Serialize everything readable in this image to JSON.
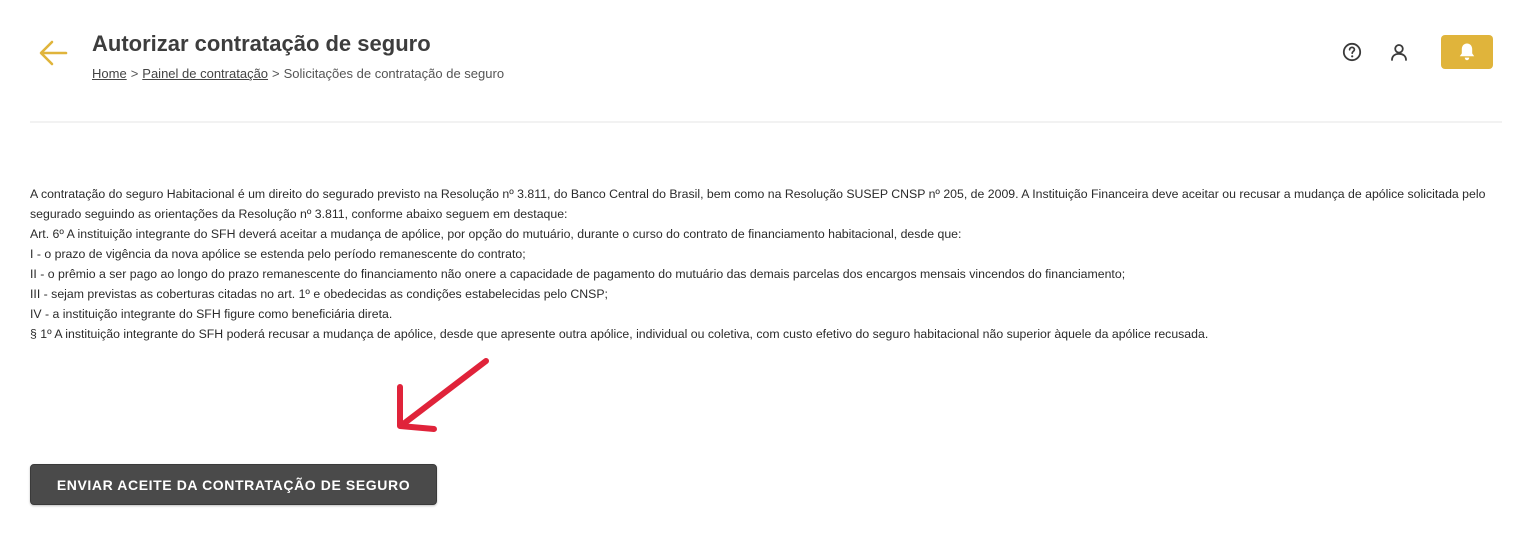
{
  "header": {
    "title": "Autorizar contratação de seguro",
    "breadcrumb": {
      "items": [
        "Home",
        "Painel de contratação"
      ],
      "separator": ">",
      "current": "Solicitações de contratação de seguro"
    },
    "icons": {
      "back": "arrow-left-icon",
      "help": "help-circle-icon",
      "user": "user-icon",
      "notifications": "bell-icon"
    }
  },
  "colors": {
    "accent": "#e0b43b",
    "button_bg": "#4a4a4a",
    "annotation_arrow": "#e0233a"
  },
  "content": {
    "paragraphs": [
      "A contratação do seguro Habitacional é um direito do segurado previsto na Resolução nº 3.811, do Banco Central do Brasil, bem como na Resolução SUSEP CNSP nº 205, de 2009. A Instituição Financeira deve aceitar ou recusar a mudança de apólice solicitada pelo segurado seguindo as orientações da Resolução nº 3.811, conforme abaixo seguem em destaque:",
      "Art. 6º A instituição integrante do SFH deverá aceitar a mudança de apólice, por opção do mutuário, durante o curso do contrato de financiamento habitacional, desde que:",
      "I - o prazo de vigência da nova apólice se estenda pelo período remanescente do contrato;",
      "II - o prêmio a ser pago ao longo do prazo remanescente do financiamento não onere a capacidade de pagamento do mutuário das demais parcelas dos encargos mensais vincendos do financiamento;",
      "III - sejam previstas as coberturas citadas no art. 1º e obedecidas as condições estabelecidas pelo CNSP;",
      "IV - a instituição integrante do SFH figure como beneficiária direta.",
      "§ 1º A instituição integrante do SFH poderá recusar a mudança de apólice, desde que apresente outra apólice, individual ou coletiva, com custo efetivo do seguro habitacional não superior àquele da apólice recusada."
    ]
  },
  "actions": {
    "submit_label": "ENVIAR ACEITE DA CONTRATAÇÃO DE SEGURO"
  }
}
